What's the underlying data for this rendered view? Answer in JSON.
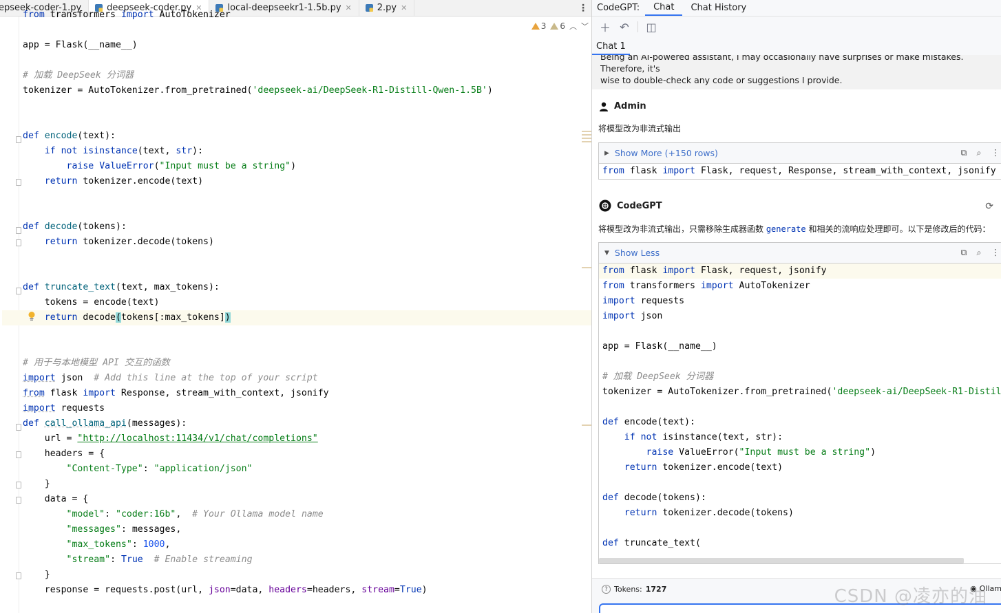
{
  "editor": {
    "tabs": [
      {
        "label": "epseek-coder-1.py",
        "icon": "python-file-icon",
        "closable": false
      },
      {
        "label": "deepseek-coder.py",
        "icon": "python-file-icon",
        "closable": true
      },
      {
        "label": "local-deepseekr1-1.5b.py",
        "icon": "python-file-icon",
        "closable": true
      },
      {
        "label": "2.py",
        "icon": "python-file-icon",
        "closable": true
      }
    ],
    "inspections": {
      "warnings": "3",
      "weak_warnings": "6"
    },
    "partial_top_line": "from transformers import AutoTokenizer"
  },
  "panel": {
    "title": "CodeGPT:",
    "tabs": [
      "Chat",
      "Chat History"
    ],
    "chat_tab": "Chat 1",
    "disclaimer_line1": "Being an AI-powered assistant, I may occasionally have surprises or make mistakes. Therefore, it's",
    "disclaimer_line2": "wise to double-check any code or suggestions I provide.",
    "user_name": "Admin",
    "user_message": "将模型改为非流式输出",
    "user_code": {
      "toggle": "Show More (+150 rows)",
      "line": "from flask import Flask, request, Response, stream_with_context, jsonify"
    },
    "bot_name": "CodeGPT",
    "bot_message_before": "将模型改为非流式输出，只需移除生成器函数 ",
    "bot_message_code": "generate",
    "bot_message_after": " 和相关的流响应处理即可。以下是修改后的代码：",
    "bot_code": {
      "toggle": "Show Less"
    },
    "tokens_label": "Tokens:",
    "tokens_value": "1727",
    "provider": "Ollam"
  },
  "watermark": "CSDN @凌亦的油",
  "colors": {
    "accent": "#3574f0",
    "keyword": "#0033b3",
    "string": "#067d17",
    "comment": "#8c8c8c"
  }
}
